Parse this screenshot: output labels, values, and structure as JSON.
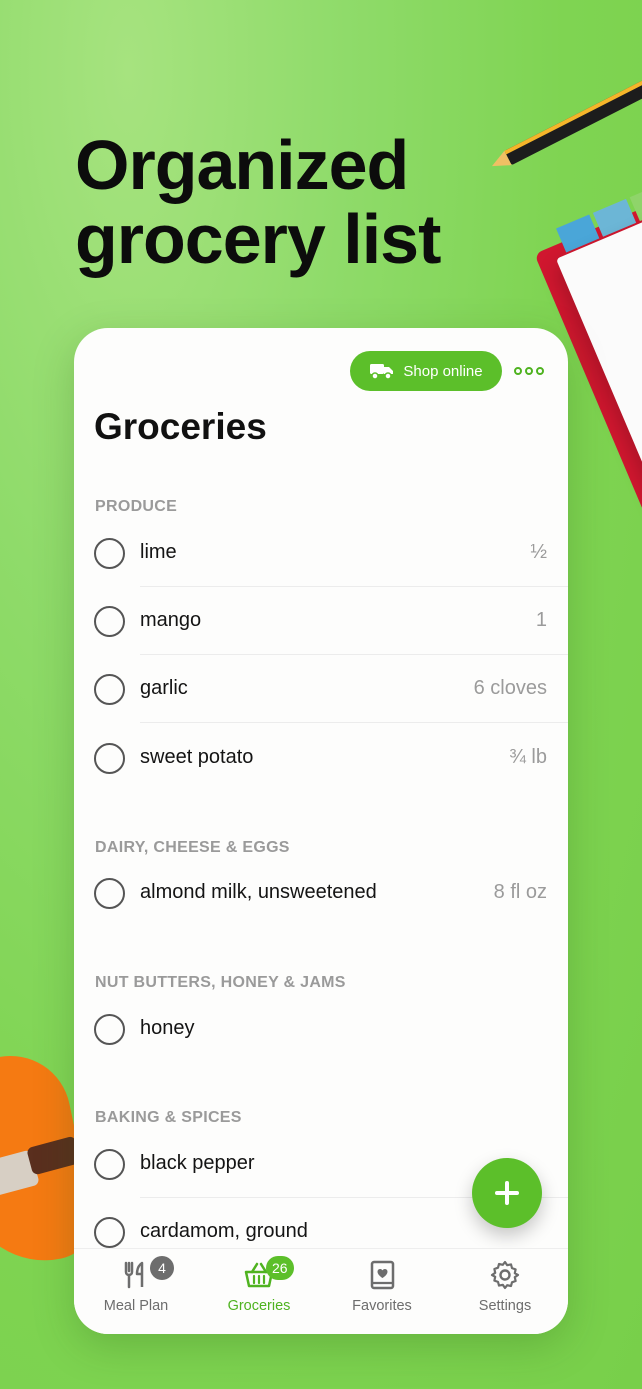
{
  "headline": {
    "line1": "Organized",
    "line2": "grocery list"
  },
  "header": {
    "shop_online_label": "Shop online",
    "title": "Groceries"
  },
  "sections": [
    {
      "title": "PRODUCE",
      "items": [
        {
          "name": "lime",
          "qty": "½"
        },
        {
          "name": "mango",
          "qty": "1"
        },
        {
          "name": "garlic",
          "qty": "6 cloves"
        },
        {
          "name": "sweet potato",
          "qty": "¾ lb"
        }
      ]
    },
    {
      "title": "DAIRY, CHEESE & EGGS",
      "items": [
        {
          "name": "almond milk, unsweetened",
          "qty": "8 fl oz"
        }
      ]
    },
    {
      "title": "NUT BUTTERS, HONEY & JAMS",
      "items": [
        {
          "name": "honey",
          "qty": ""
        }
      ]
    },
    {
      "title": "BAKING & SPICES",
      "items": [
        {
          "name": "black pepper",
          "qty": ""
        },
        {
          "name": "cardamom, ground",
          "qty": ""
        }
      ]
    }
  ],
  "tabbar": {
    "items": [
      {
        "label": "Meal Plan",
        "icon": "fork-knife-icon",
        "badge": "4",
        "active": false
      },
      {
        "label": "Groceries",
        "icon": "basket-icon",
        "badge": "26",
        "active": true
      },
      {
        "label": "Favorites",
        "icon": "heart-book-icon",
        "badge": "",
        "active": false
      },
      {
        "label": "Settings",
        "icon": "gear-icon",
        "badge": "",
        "active": false
      }
    ]
  },
  "colors": {
    "accent": "#5cbf2a",
    "background": "#84d655",
    "badge_gray": "#6d6d6d"
  }
}
